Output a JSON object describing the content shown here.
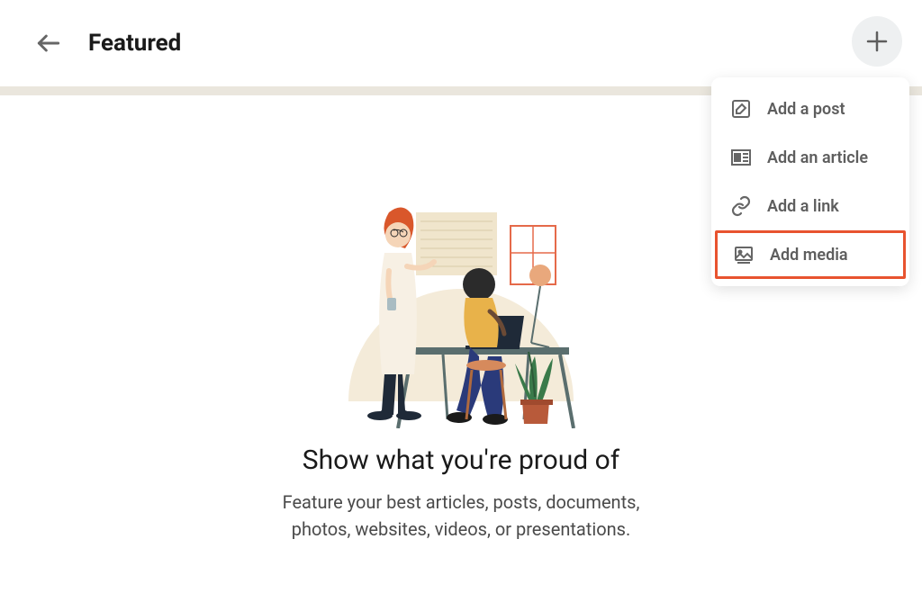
{
  "header": {
    "title": "Featured"
  },
  "content": {
    "headline": "Show what you're proud of",
    "subtext": "Feature your best articles, posts, documents, photos, websites, videos, or presentations."
  },
  "dropdown": {
    "items": [
      {
        "label": "Add a post",
        "icon": "edit"
      },
      {
        "label": "Add an article",
        "icon": "article"
      },
      {
        "label": "Add a link",
        "icon": "link"
      },
      {
        "label": "Add media",
        "icon": "media"
      }
    ]
  }
}
